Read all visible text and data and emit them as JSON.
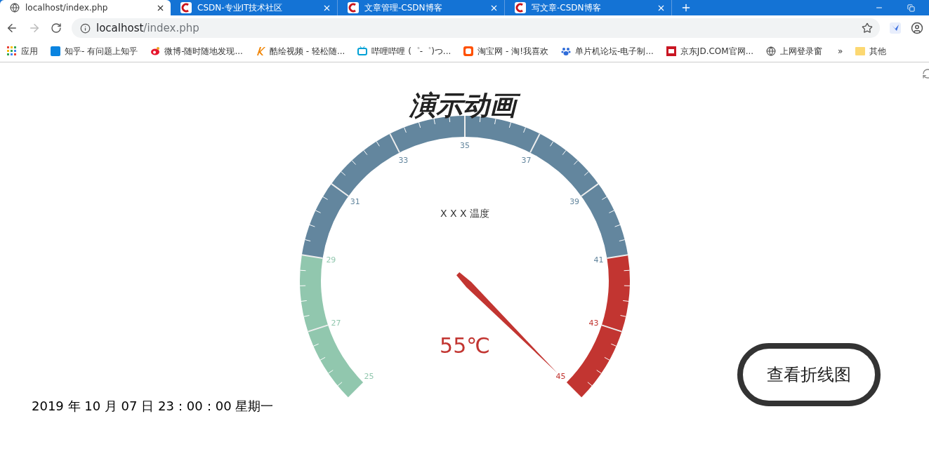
{
  "browser": {
    "tabs": [
      {
        "title": "localhost/index.php",
        "selected": true
      },
      {
        "title": "CSDN-专业IT技术社区",
        "selected": false
      },
      {
        "title": "文章管理-CSDN博客",
        "selected": false
      },
      {
        "title": "写文章-CSDN博客",
        "selected": false
      }
    ],
    "address": {
      "host": "localhost",
      "path": "/index.php"
    },
    "bookmarks": [
      {
        "label": "应用"
      },
      {
        "label": "知乎- 有问题上知乎"
      },
      {
        "label": "微博-随时随地发现..."
      },
      {
        "label": "酷绘视频 - 轻松随..."
      },
      {
        "label": "哔哩哔哩 (゜-゜)つ..."
      },
      {
        "label": "淘宝网 - 淘!我喜欢"
      },
      {
        "label": "单片机论坛-电子制..."
      },
      {
        "label": "京东JD.COM官网..."
      },
      {
        "label": "上网登录窗"
      }
    ],
    "more": "»",
    "other_bookmarks": "其他"
  },
  "page": {
    "title": "演示动画",
    "gauge": {
      "name": "X X X 温度",
      "value_text": "55℃",
      "axis_labels": [
        "25",
        "27",
        "29",
        "31",
        "33",
        "35",
        "37",
        "39",
        "41",
        "43",
        "45"
      ],
      "bands": [
        {
          "color": "#91c7ae"
        },
        {
          "color": "#63869e"
        },
        {
          "color": "#c23531"
        }
      ]
    },
    "datetime": "2019 年 10 月 07 日 23：00：00 星期一",
    "button": "查看折线图"
  }
}
